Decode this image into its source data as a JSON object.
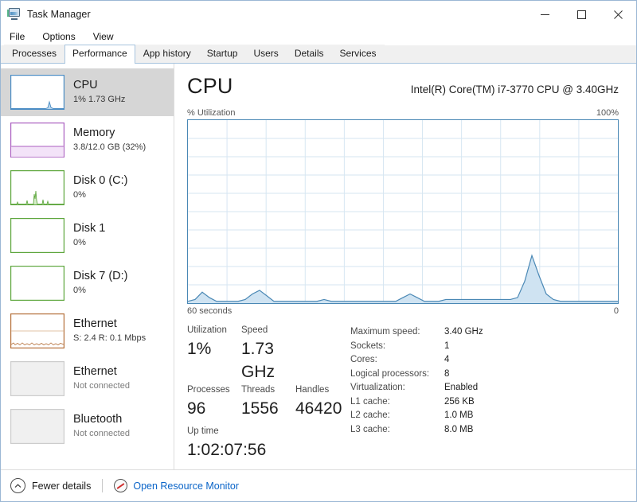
{
  "window": {
    "title": "Task Manager",
    "icon": "task-manager-icon",
    "controls": {
      "minimize": "─",
      "maximize": "□",
      "close": "✕"
    }
  },
  "menu": {
    "items": [
      "File",
      "Options",
      "View"
    ]
  },
  "tabs": {
    "items": [
      "Processes",
      "Performance",
      "App history",
      "Startup",
      "Users",
      "Details",
      "Services"
    ],
    "active": "Performance"
  },
  "sidebar": {
    "items": [
      {
        "title": "CPU",
        "sub": "1% 1.73 GHz",
        "selected": true,
        "color": "#4a8cc4",
        "state": "active"
      },
      {
        "title": "Memory",
        "sub": "3.8/12.0 GB (32%)",
        "selected": false,
        "color": "#ab5fc0",
        "state": "active"
      },
      {
        "title": "Disk 0 (C:)",
        "sub": "0%",
        "selected": false,
        "color": "#5da63c",
        "state": "active"
      },
      {
        "title": "Disk 1",
        "sub": "0%",
        "selected": false,
        "color": "#5da63c",
        "state": "active"
      },
      {
        "title": "Disk 7 (D:)",
        "sub": "0%",
        "selected": false,
        "color": "#5da63c",
        "state": "active"
      },
      {
        "title": "Ethernet",
        "sub_send_label": "S:",
        "sub_send": "2.4",
        "sub_recv_label": "R:",
        "sub_recv": "0.1 Mbps",
        "sub": "S: 2.4 R: 0.1 Mbps",
        "selected": false,
        "color": "#b5703a",
        "state": "active"
      },
      {
        "title": "Ethernet",
        "sub": "Not connected",
        "selected": false,
        "color": "#cccccc",
        "state": "disconnected"
      },
      {
        "title": "Bluetooth",
        "sub": "Not connected",
        "selected": false,
        "color": "#cccccc",
        "state": "disconnected"
      }
    ]
  },
  "main": {
    "title": "CPU",
    "processor": "Intel(R) Core(TM) i7-3770 CPU @ 3.40GHz",
    "graph_axis_label": "% Utilization",
    "graph_axis_max": "100%",
    "graph_time_left": "60 seconds",
    "graph_time_right": "0",
    "stats": {
      "utilization_label": "Utilization",
      "utilization_value": "1%",
      "speed_label": "Speed",
      "speed_value": "1.73 GHz",
      "processes_label": "Processes",
      "processes_value": "96",
      "threads_label": "Threads",
      "threads_value": "1556",
      "handles_label": "Handles",
      "handles_value": "46420",
      "uptime_label": "Up time",
      "uptime_value": "1:02:07:56"
    },
    "specs": [
      {
        "key": "Maximum speed:",
        "value": "3.40 GHz"
      },
      {
        "key": "Sockets:",
        "value": "1"
      },
      {
        "key": "Cores:",
        "value": "4"
      },
      {
        "key": "Logical processors:",
        "value": "8"
      },
      {
        "key": "Virtualization:",
        "value": "Enabled"
      },
      {
        "key": "L1 cache:",
        "value": "256 KB"
      },
      {
        "key": "L2 cache:",
        "value": "1.0 MB"
      },
      {
        "key": "L3 cache:",
        "value": "8.0 MB"
      }
    ]
  },
  "footer": {
    "fewer_details": "Fewer details",
    "resource_monitor": "Open Resource Monitor"
  },
  "chart_data": {
    "type": "area",
    "title": "CPU Utilization over time",
    "xlabel": "seconds ago",
    "ylabel": "% Utilization",
    "ylim": [
      0,
      100
    ],
    "xlim": [
      60,
      0
    ],
    "grid": true,
    "accent_color": "#4a88b5",
    "fill_color": "#cfe3f2",
    "series": [
      {
        "name": "% Utilization",
        "values": [
          1,
          2,
          6,
          3,
          1,
          1,
          1,
          1,
          2,
          5,
          7,
          4,
          1,
          1,
          1,
          1,
          1,
          1,
          1,
          2,
          1,
          1,
          1,
          1,
          1,
          1,
          1,
          1,
          1,
          1,
          3,
          5,
          3,
          1,
          1,
          1,
          2,
          2,
          2,
          2,
          2,
          2,
          2,
          2,
          2,
          2,
          3,
          12,
          26,
          15,
          5,
          2,
          1,
          1,
          1,
          1,
          1,
          1,
          1,
          1,
          1
        ]
      }
    ]
  }
}
